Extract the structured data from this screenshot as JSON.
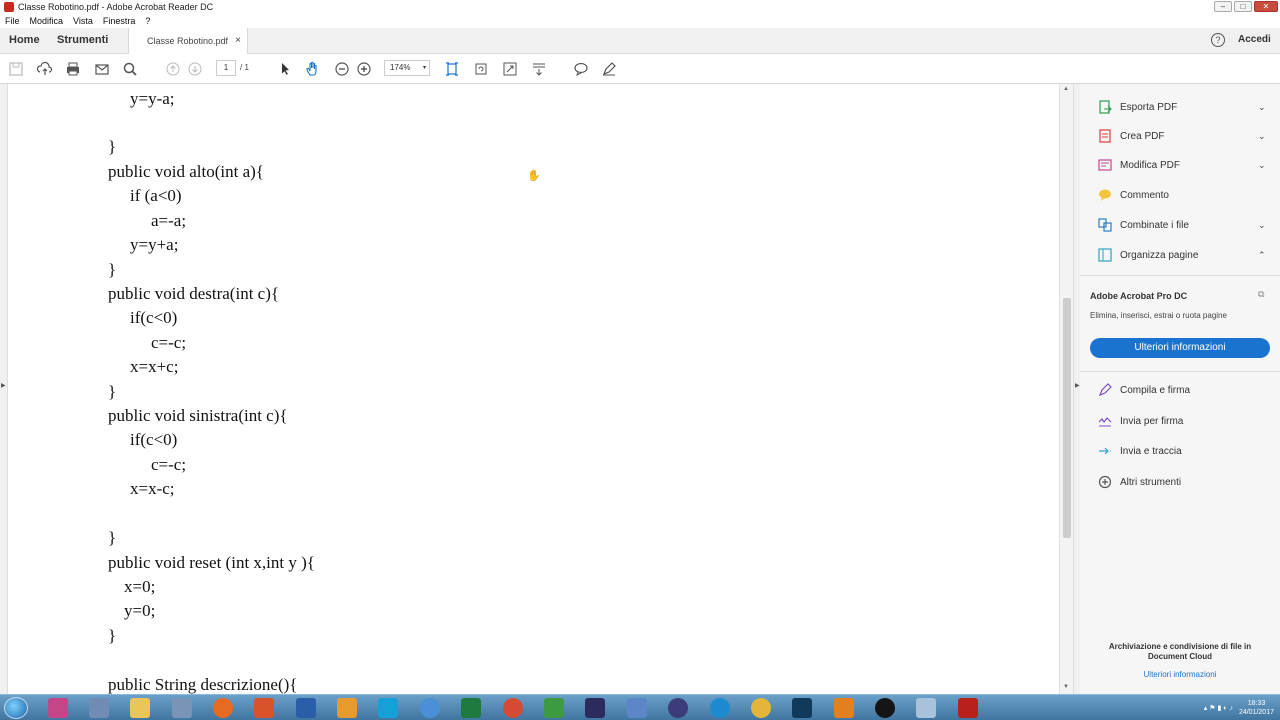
{
  "window": {
    "title": "Classe Robotino.pdf - Adobe Acrobat Reader DC"
  },
  "menu": [
    "File",
    "Modifica",
    "Vista",
    "Finestra",
    "?"
  ],
  "tabs": {
    "home": "Home",
    "tools": "Strumenti",
    "document": "Classe Robotino.pdf",
    "close": "×",
    "help": "?",
    "login": "Accedi"
  },
  "toolbar": {
    "page_current": "1",
    "page_total": "/ 1",
    "zoom": "174%",
    "zoom_caret": "▾"
  },
  "document": {
    "lines": [
      "y=y-a;",
      "}",
      "public void alto(int a){",
      "if (a<0)",
      "a=-a;",
      "y=y+a;",
      "}",
      "public void destra(int c){",
      "if(c<0)",
      "c=-c;",
      "x=x+c;",
      "}",
      "public void sinistra(int c){",
      "if(c<0)",
      "c=-c;",
      "x=x-c;",
      "}",
      "public void reset (int x,int y ){",
      "x=0;",
      "y=0;",
      "}",
      "public String descrizione(){"
    ]
  },
  "rightpanel": {
    "tools": [
      {
        "label": "Esporta PDF",
        "icon": "export-pdf-icon",
        "chev": "⌄"
      },
      {
        "label": "Crea PDF",
        "icon": "create-pdf-icon",
        "chev": "⌄"
      },
      {
        "label": "Modifica PDF",
        "icon": "edit-pdf-icon",
        "chev": "⌄"
      },
      {
        "label": "Commento",
        "icon": "comment-icon",
        "chev": ""
      },
      {
        "label": "Combinate i file",
        "icon": "combine-files-icon",
        "chev": "⌄"
      },
      {
        "label": "Organizza pagine",
        "icon": "organize-pages-icon",
        "chev": "⌃"
      }
    ],
    "promo": {
      "title": "Adobe Acrobat Pro DC",
      "subtitle": "Elimina, inserisci, estrai o ruota pagine",
      "button": "Ulteriori informazioni"
    },
    "tools2": [
      {
        "label": "Compila e firma",
        "icon": "fill-sign-icon"
      },
      {
        "label": "Invia per firma",
        "icon": "send-for-signature-icon"
      },
      {
        "label": "Invia e traccia",
        "icon": "send-track-icon"
      },
      {
        "label": "Altri strumenti",
        "icon": "more-tools-icon"
      }
    ],
    "cloud": {
      "title": "Archiviazione e condivisione di file in Document Cloud",
      "link": "Ulteriori informazioni"
    }
  },
  "taskbar": {
    "time": "18:33",
    "date": "24/01/2017"
  },
  "colors": {
    "accent": "#1b73d0",
    "taskbar": "#4a80ab"
  }
}
